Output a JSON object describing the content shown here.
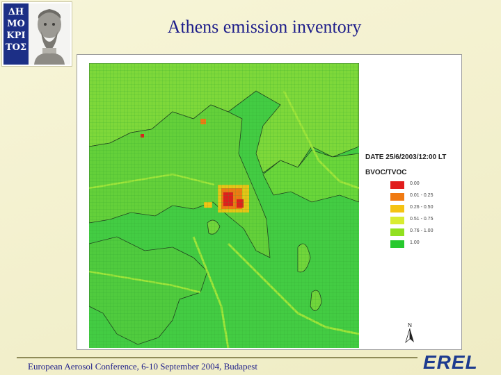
{
  "slide": {
    "title": "Athens emission inventory",
    "footer": "European Aerosol Conference, 6-10 September 2004, Budapest",
    "brand": "EREL"
  },
  "logo": {
    "letters": [
      "ΔΗ",
      "ΜΟ",
      "ΚΡΙ",
      "ΤΟΣ"
    ]
  },
  "map": {
    "date_label": "DATE 25/6/2003/12:00 LT",
    "legend_title": "BVOC/TVOC",
    "north_label": "N",
    "legend": [
      {
        "label": "0.00",
        "color": "#e11d1d"
      },
      {
        "label": "0.01 - 0.25",
        "color": "#f07a12"
      },
      {
        "label": "0.26 - 0.50",
        "color": "#f5c313"
      },
      {
        "label": "0.51 - 0.75",
        "color": "#d9ec32"
      },
      {
        "label": "0.76 - 1.00",
        "color": "#92e01f"
      },
      {
        "label": "1.00",
        "color": "#27c92e"
      }
    ],
    "colors": {
      "background_land": "#39c83a",
      "sea": "#4bd14a",
      "coast": "#1f3c1e"
    }
  }
}
